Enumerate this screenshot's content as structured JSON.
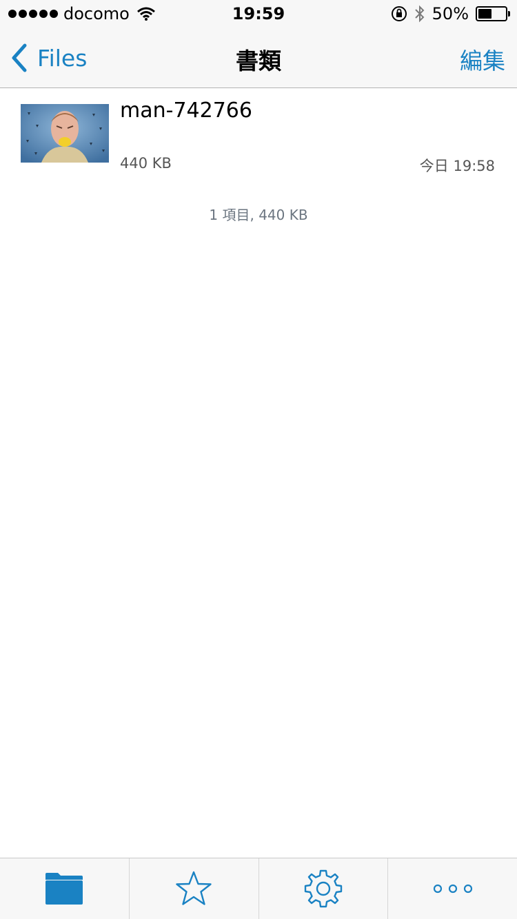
{
  "status_bar": {
    "carrier": "docomo",
    "time": "19:59",
    "battery_percent_label": "50%",
    "battery_level": 0.5,
    "icons": [
      "signal-dots-icon",
      "wifi-icon",
      "rotation-lock-icon",
      "bluetooth-icon",
      "battery-icon"
    ]
  },
  "nav": {
    "back_label": "Files",
    "title": "書類",
    "edit_label": "編集"
  },
  "files": [
    {
      "name": "man-742766",
      "size": "440 KB",
      "date": "今日 19:58",
      "thumbnail": "portrait-photo"
    }
  ],
  "summary": "1 項目, 440 KB",
  "tabs": [
    {
      "icon": "folder-icon",
      "selected": true
    },
    {
      "icon": "star-icon",
      "selected": false
    },
    {
      "icon": "gear-icon",
      "selected": false
    },
    {
      "icon": "more-icon",
      "selected": false
    }
  ],
  "colors": {
    "accent": "#1a82c3",
    "bar_background": "#f7f7f7",
    "secondary_text": "#555555",
    "summary_text": "#6b7580"
  }
}
